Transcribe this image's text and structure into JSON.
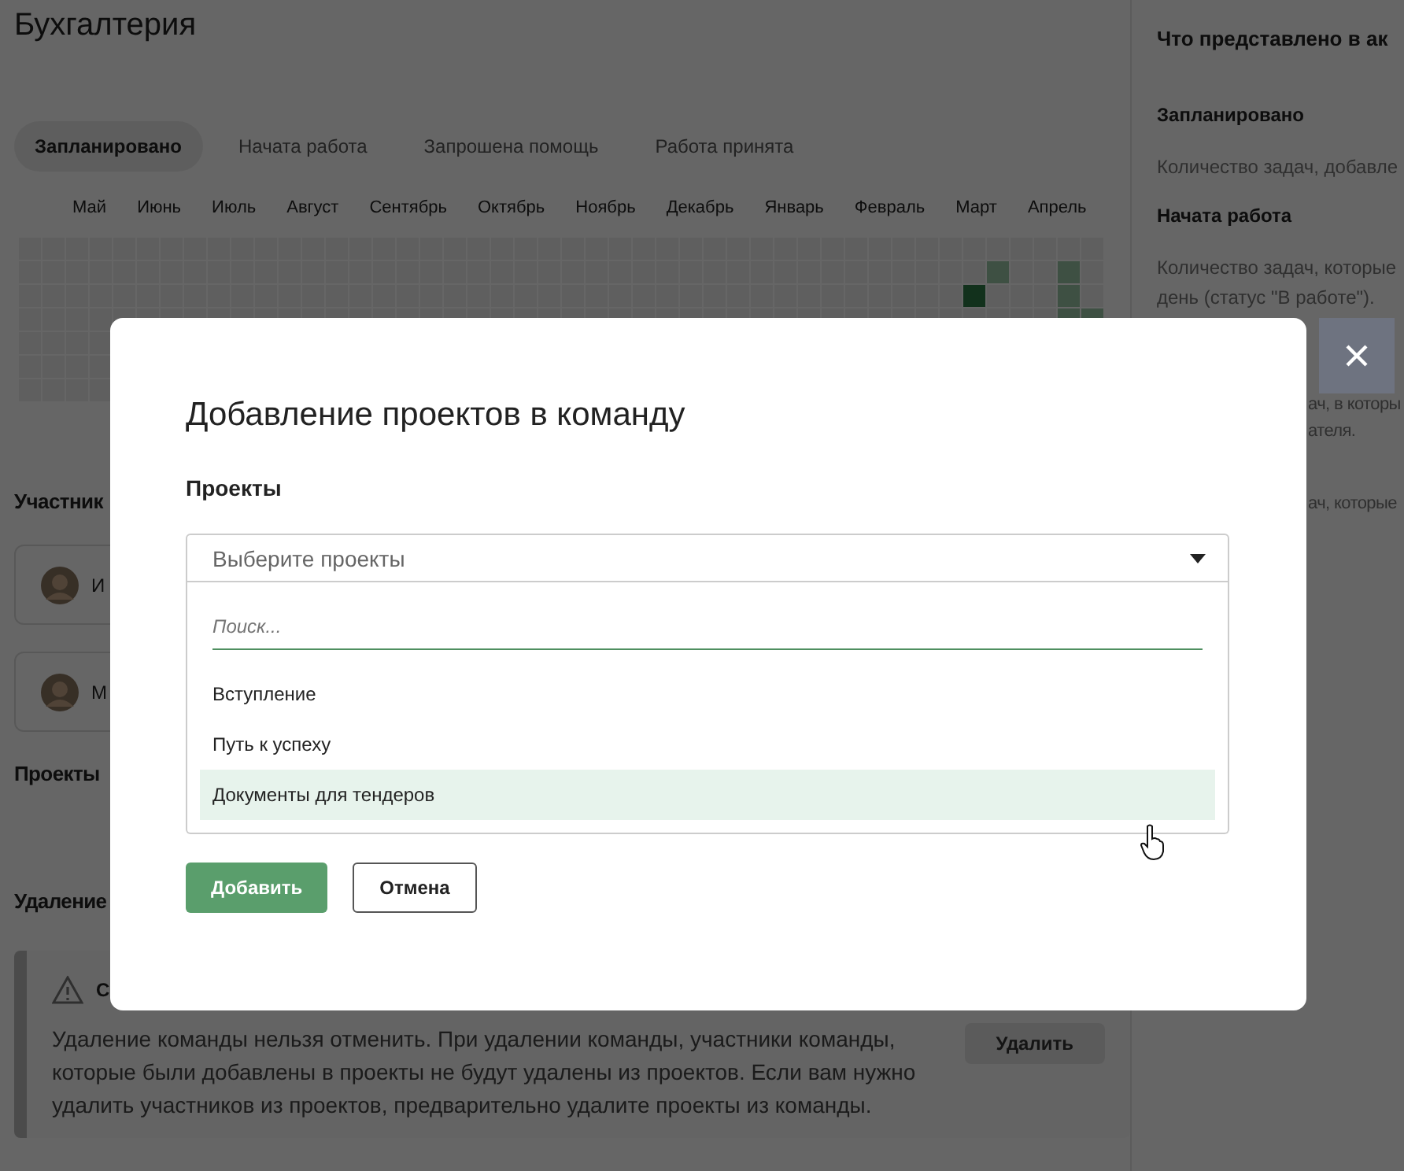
{
  "page": {
    "title": "Бухгалтерия",
    "tabs": [
      {
        "label": "Запланировано",
        "selected": true
      },
      {
        "label": "Начата работа",
        "selected": false
      },
      {
        "label": "Запрошена помощь",
        "selected": false
      },
      {
        "label": "Работа принята",
        "selected": false
      }
    ],
    "months": [
      "Май",
      "Июнь",
      "Июль",
      "Август",
      "Сентябрь",
      "Октябрь",
      "Ноябрь",
      "Декабрь",
      "Январь",
      "Февраль",
      "Март",
      "Апрель"
    ],
    "members_heading": "Участник",
    "members": [
      {
        "name": "И"
      },
      {
        "name": "М"
      }
    ],
    "projects_heading": "Проекты",
    "delete_heading": "Удаление",
    "warning": {
      "title": "С",
      "text": "Удаление команды нельзя отменить. При удалении команды, участники команды, которые были добавлены в проекты не будут удалены из проектов. Если вам нужно удалить участников из проектов, предварительно удалите проекты из команды.",
      "button": "Удалить"
    }
  },
  "info_panel": {
    "title": "Что представлено в ак",
    "sections": [
      {
        "heading": "Запланировано",
        "text": "Количество задач, добавле"
      },
      {
        "heading": "Начата работа",
        "text": "Количество задач, которые\nдень (статус \"В работе\")."
      }
    ],
    "fragments": [
      "ач, в которы\nателя.",
      "ач, которые"
    ]
  },
  "dialog": {
    "title": "Добавление проектов в команду",
    "field_label": "Проекты",
    "select": {
      "placeholder": "Выберите проекты",
      "expanded": true
    },
    "search": {
      "placeholder": "Поиск..."
    },
    "options": [
      {
        "label": "Вступление",
        "hovered": false
      },
      {
        "label": "Путь к успеху",
        "hovered": false
      },
      {
        "label": "Документы для тендеров",
        "hovered": true
      }
    ],
    "buttons": [
      {
        "label": "Добавить",
        "kind": "primary"
      },
      {
        "label": "Отмена",
        "kind": "secondary"
      }
    ]
  }
}
